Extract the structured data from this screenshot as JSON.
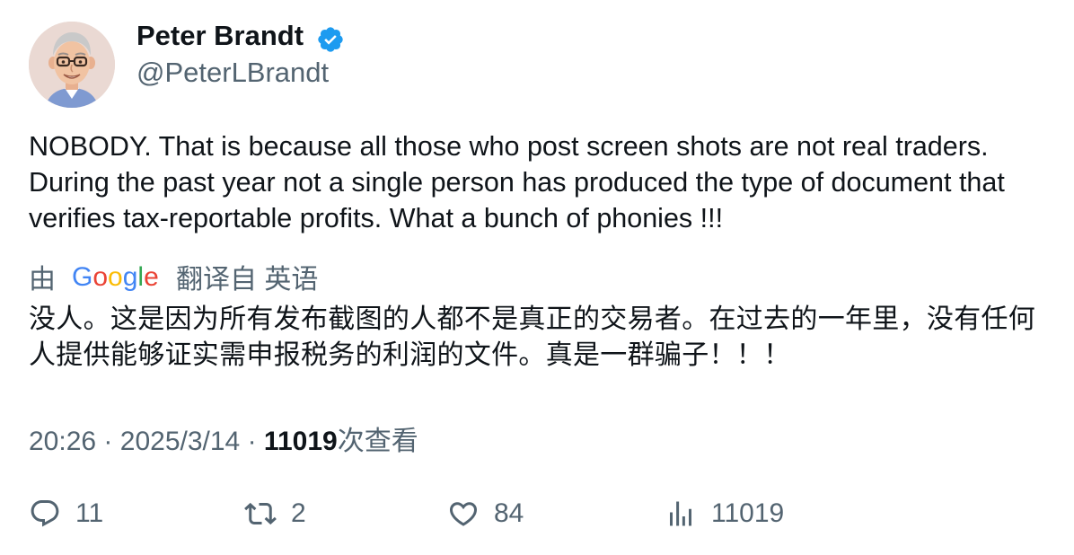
{
  "author": {
    "name": "Peter Brandt",
    "handle": "@PeterLBrandt",
    "verified": true
  },
  "tweet": {
    "text": "NOBODY. That is because all those who post screen shots are not real traders. During the past year not a single person has produced the type of document that verifies tax-reportable profits. What a bunch of phonies !!!"
  },
  "translation": {
    "prefix": "由",
    "provider": "Google",
    "suffix": "翻译自 英语",
    "text": "没人。这是因为所有发布截图的人都不是真正的交易者。在过去的一年里，没有任何人提供能够证实需申报税务的利润的文件。真是一群骗子！！！"
  },
  "meta": {
    "time": "20:26",
    "separator": "·",
    "date": "2025/3/14",
    "views_count": "11019",
    "views_label": "次查看"
  },
  "actions": {
    "replies": "11",
    "retweets": "2",
    "likes": "84",
    "views": "11019"
  },
  "colors": {
    "text": "#0f1419",
    "secondary": "#536471",
    "verified": "#1d9bf0",
    "google_blue": "#4285f4",
    "google_red": "#ea4335",
    "google_yellow": "#fbbc05",
    "google_green": "#34a853"
  },
  "icons": {
    "verified": "verified-badge-icon",
    "reply": "reply-bubble-icon",
    "retweet": "retweet-arrows-icon",
    "like": "heart-icon",
    "views": "bar-chart-icon"
  }
}
